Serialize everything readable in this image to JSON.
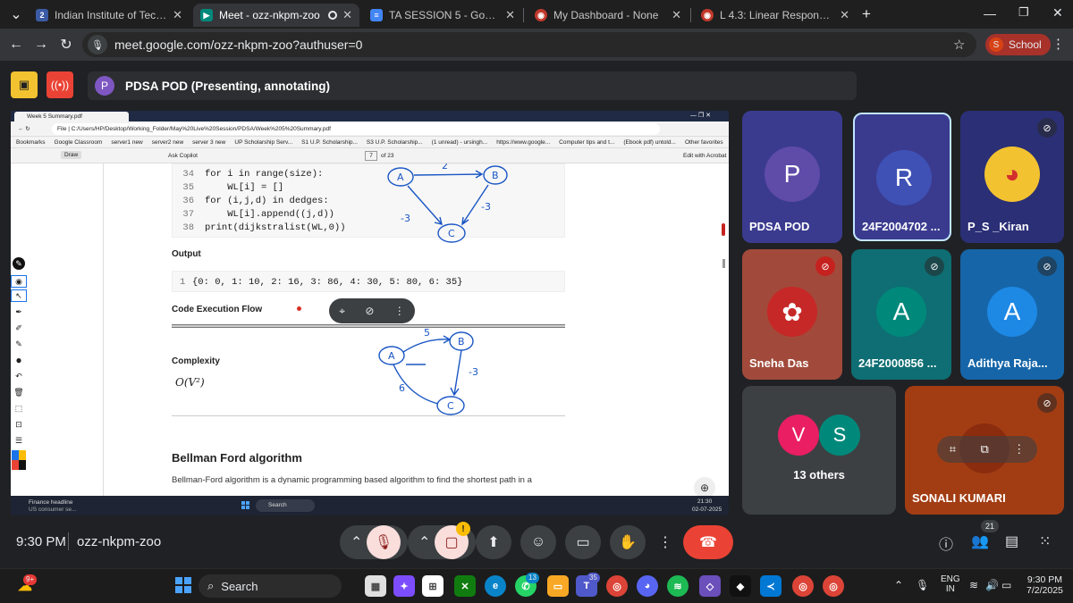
{
  "browser": {
    "tabs": [
      {
        "title": "Indian Institute of Technology M",
        "icon": "site-icon",
        "active": false
      },
      {
        "title": "Meet - ozz-nkpm-zoo",
        "icon": "meet-icon",
        "active": true
      },
      {
        "title": "TA SESSION 5 - Google Docs",
        "icon": "docs-icon",
        "active": false
      },
      {
        "title": "My Dashboard - None",
        "icon": "dashboard-icon",
        "active": false
      },
      {
        "title": "L 4.3: Linear Response Curve :: I",
        "icon": "video-icon",
        "active": false
      }
    ],
    "new_tab": "+",
    "url": "meet.google.com/ozz-nkpm-zoo?authuser=0",
    "profile_initial": "S",
    "profile_label": "School"
  },
  "meet_header": {
    "presenter_initial": "P",
    "title": "PDSA POD (Presenting, annotating)"
  },
  "shared_screen": {
    "tab_title": "Week 5 Summary.pdf",
    "address": "C:/Users/HP/Desktop/Working_Folder/May%20Live%20Session/PDSA/Week%205%20Summary.pdf",
    "file_label": "File",
    "bookmarks": [
      "Bookmarks",
      "Google Classroom",
      "server1 new",
      "server2 new",
      "server 3 new",
      "UP Scholarship Serv...",
      "S1 U.P. Scholarship...",
      "S3 U.P. Scholarship...",
      "(1 unread) - ursingh...",
      "https://www.google...",
      "Computer tips and t...",
      "(Ebook pdf) untold..."
    ],
    "other_favorites": "Other favorites",
    "toolbar": {
      "draw": "Draw",
      "ask_copilot": "Ask Copilot",
      "page": "7",
      "of_pages": "of 23",
      "edit": "Edit with Acrobat"
    },
    "code_lines": [
      {
        "n": "34",
        "text": "for i in range(size):"
      },
      {
        "n": "35",
        "text": "    WL[i] = []"
      },
      {
        "n": "36",
        "text": "for (i,j,d) in dedges:"
      },
      {
        "n": "37",
        "text": "    WL[i].append((j,d))"
      },
      {
        "n": "38",
        "text": "print(dijkstralist(WL,0))"
      }
    ],
    "output_heading": "Output",
    "output_line_no": "1",
    "output_text": "{0: 0, 1: 10, 2: 16, 3: 86, 4: 30, 5: 80, 6: 35}",
    "flow_heading": "Code Execution Flow",
    "complexity_heading": "Complexity",
    "complexity_value": "O(V²)",
    "bellman_heading": "Bellman Ford algorithm",
    "bellman_text": "Bellman-Ford algorithm is a dynamic programming based algorithm to find the shortest path in a",
    "sketch1": {
      "nodes": [
        "A",
        "B",
        "C"
      ],
      "weights": [
        "2",
        "-3",
        "-3"
      ]
    },
    "sketch2": {
      "nodes": [
        "A",
        "B",
        "C"
      ],
      "weights": [
        "5",
        "-3",
        "6"
      ]
    },
    "win_taskbar": {
      "news_title": "Finance headline",
      "news_sub": "US consumer se...",
      "search": "Search",
      "time": "21:30",
      "date": "02-07-2025"
    }
  },
  "participants": [
    {
      "name": "PDSA POD",
      "initial": "P",
      "color": "#5f4ba8",
      "bg": "#3a3b8f",
      "muted": false
    },
    {
      "name": "24F2004702 ...",
      "initial": "R",
      "color": "#3f51b5",
      "bg": "#3a3b8f",
      "muted": false
    },
    {
      "name": "P_S _Kiran",
      "initial": "",
      "color": "#f2c230",
      "bg": "#2b2f76",
      "muted": true
    },
    {
      "name": "Sneha Das",
      "initial": "",
      "color": "#c62828",
      "bg": "#a14a3b",
      "muted": true
    },
    {
      "name": "24F2000856 ...",
      "initial": "A",
      "color": "#00897b",
      "bg": "#0e6e73",
      "muted": true
    },
    {
      "name": "Adithya Raja...",
      "initial": "A",
      "color": "#1e88e5",
      "bg": "#1565a8",
      "muted": true
    },
    {
      "name": "13 others",
      "initial": "V",
      "initial2": "S",
      "color": "#e91e63",
      "color2": "#00897b",
      "bg": "#3c4043"
    },
    {
      "name": "SONALI KUMARI",
      "initial": "",
      "color": "#8b2c0f",
      "bg": "#a23d13",
      "muted": true
    }
  ],
  "controls": {
    "meeting_code": "ozz-nkpm-zoo",
    "time": "9:30 PM",
    "people_count": "21",
    "camera_alert": "!"
  },
  "taskbar": {
    "weather_badge": "9+",
    "search": "Search",
    "whatsapp_badge": "13",
    "teams_badge": "35",
    "lang": "ENG",
    "region": "IN",
    "time": "9:30 PM",
    "date": "7/2/2025"
  },
  "colors": {
    "accent": "#8ab4f8",
    "hangup": "#ea4335",
    "present": "#f28b82"
  }
}
